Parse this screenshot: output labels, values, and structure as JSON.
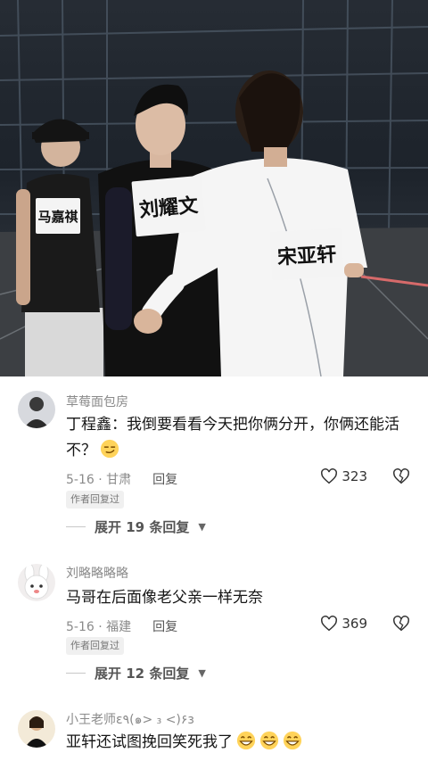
{
  "photo": {
    "tags": {
      "ma": "马嘉祺",
      "liu": "刘耀文",
      "song": "宋亚轩"
    }
  },
  "comments": [
    {
      "username": "草莓面包房",
      "text": "丁程鑫：我倒要看看今天把你俩分开，你俩还能活不？",
      "date": "5-16",
      "location": "甘肃",
      "reply_label": "回复",
      "likes": "323",
      "author_badge": "作者回复过",
      "expand": "展开 19 条回复",
      "emoji": [
        "smirk-emoji"
      ]
    },
    {
      "username": "刘略略略略",
      "text": "马哥在后面像老父亲一样无奈",
      "date": "5-16",
      "location": "福建",
      "reply_label": "回复",
      "likes": "369",
      "author_badge": "作者回复过",
      "expand": "展开 12 条回复"
    },
    {
      "username": "小王老师ε٩(๑> ₃ <)۶з",
      "text": "亚轩还试图挽回笑死我了",
      "emoji": [
        "grin-emoji",
        "grin-emoji",
        "grin-emoji"
      ]
    }
  ]
}
